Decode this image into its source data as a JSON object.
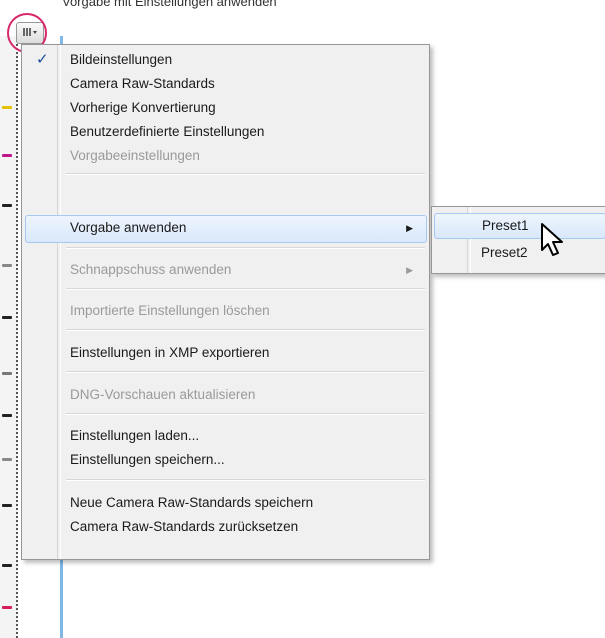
{
  "caption": "Vorgabe mit Einstellungen anwenden",
  "flyout_icon": "flyout-menu-icon",
  "menu": {
    "items": [
      {
        "label": "Bildeinstellungen",
        "checked": true
      },
      {
        "label": "Camera Raw-Standards"
      },
      {
        "label": "Vorherige Konvertierung"
      },
      {
        "label": "Benutzerdefinierte Einstellungen"
      },
      {
        "label": "Vorgabeeinstellungen",
        "disabled": true
      },
      {
        "label": "Vorgabe anwenden",
        "submenu": true,
        "highlighted": true
      },
      {
        "label": "Schnappschuss anwenden",
        "submenu": true,
        "disabled": true
      },
      {
        "label": "Importierte Einstellungen löschen",
        "disabled": true
      },
      {
        "label": "Einstellungen in XMP exportieren"
      },
      {
        "label": "DNG-Vorschauen aktualisieren",
        "disabled": true
      },
      {
        "label": "Einstellungen laden..."
      },
      {
        "label": "Einstellungen speichern..."
      },
      {
        "label": "Neue Camera Raw-Standards speichern"
      },
      {
        "label": "Camera Raw-Standards zurücksetzen"
      }
    ]
  },
  "submenu": {
    "items": [
      {
        "label": "Preset1",
        "highlighted": true
      },
      {
        "label": "Preset2"
      }
    ]
  },
  "colors": {
    "highlight": "#d9e8fb",
    "highlight_border": "#a6c9ef",
    "annotation_circle": "#d6286b",
    "check": "#1d4d9c"
  }
}
